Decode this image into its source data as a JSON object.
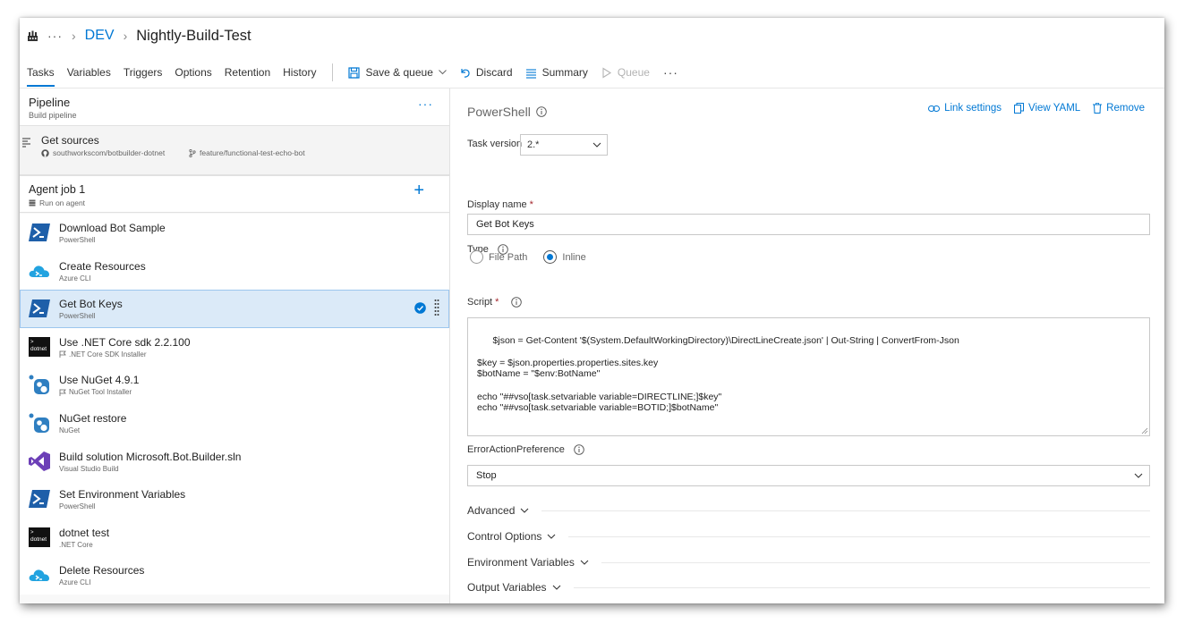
{
  "breadcrumb": {
    "more": "···",
    "project": "DEV",
    "pipeline": "Nightly-Build-Test"
  },
  "tabs": [
    {
      "label": "Tasks",
      "active": true
    },
    {
      "label": "Variables",
      "active": false
    },
    {
      "label": "Triggers",
      "active": false
    },
    {
      "label": "Options",
      "active": false
    },
    {
      "label": "Retention",
      "active": false
    },
    {
      "label": "History",
      "active": false
    }
  ],
  "toolbar": {
    "save_queue": "Save & queue",
    "discard": "Discard",
    "summary": "Summary",
    "queue": "Queue",
    "more": "···"
  },
  "pipeline": {
    "title": "Pipeline",
    "subtitle": "Build pipeline",
    "more": "···"
  },
  "get_sources": {
    "title": "Get sources",
    "repo": "southworkscom/botbuilder-dotnet",
    "branch": "feature/functional-test-echo-bot"
  },
  "agent_job": {
    "title": "Agent job 1",
    "subtitle": "Run on agent",
    "add": "+"
  },
  "tasks": [
    {
      "name": "Download Bot Sample",
      "sub": "PowerShell",
      "icon": "powershell-icon",
      "flag": false
    },
    {
      "name": "Create Resources",
      "sub": "Azure CLI",
      "icon": "azure-cli-icon",
      "flag": false
    },
    {
      "name": "Get Bot Keys",
      "sub": "PowerShell",
      "icon": "powershell-icon",
      "flag": false
    },
    {
      "name": "Use .NET Core sdk 2.2.100",
      "sub": ".NET Core SDK Installer",
      "icon": "dotnet-icon",
      "flag": true
    },
    {
      "name": "Use NuGet 4.9.1",
      "sub": "NuGet Tool Installer",
      "icon": "nuget-icon",
      "flag": true
    },
    {
      "name": "NuGet restore",
      "sub": "NuGet",
      "icon": "nuget-icon",
      "flag": false
    },
    {
      "name": "Build solution Microsoft.Bot.Builder.sln",
      "sub": "Visual Studio Build",
      "icon": "visual-studio-icon",
      "flag": false
    },
    {
      "name": "Set Environment Variables",
      "sub": "PowerShell",
      "icon": "powershell-icon",
      "flag": false
    },
    {
      "name": "dotnet test",
      "sub": ".NET Core",
      "icon": "dotnet-icon",
      "flag": false
    },
    {
      "name": "Delete Resources",
      "sub": "Azure CLI",
      "icon": "azure-cli-icon",
      "flag": false
    }
  ],
  "dotnet_icon_text": "dotnet",
  "detail": {
    "title": "PowerShell",
    "link_settings": "Link settings",
    "view_yaml": "View YAML",
    "remove": "Remove",
    "task_version_label": "Task version",
    "task_version_value": "2.*",
    "display_name_label": "Display name",
    "required_mark": "*",
    "display_name_value": "Get Bot Keys",
    "type_label": "Type",
    "type_options": [
      "File Path",
      "Inline"
    ],
    "type_selected": "Inline",
    "script_label": "Script",
    "script_value": "$json = Get-Content '$(System.DefaultWorkingDirectory)\\DirectLineCreate.json' | Out-String | ConvertFrom-Json\n\n$key = $json.properties.properties.sites.key\n$botName = \"$env:BotName\"\n\necho \"##vso[task.setvariable variable=DIRECTLINE;]$key\"\necho \"##vso[task.setvariable variable=BOTID;]$botName\"",
    "error_pref_label": "ErrorActionPreference",
    "error_pref_value": "Stop",
    "sections": [
      "Advanced",
      "Control Options",
      "Environment Variables",
      "Output Variables"
    ]
  },
  "colors": {
    "accent": "#0078d4",
    "selected_bg": "#dbeaf8",
    "powershell": "#1e5fa9",
    "azure": "#22a3e0",
    "visual_studio": "#6c3fb7"
  }
}
